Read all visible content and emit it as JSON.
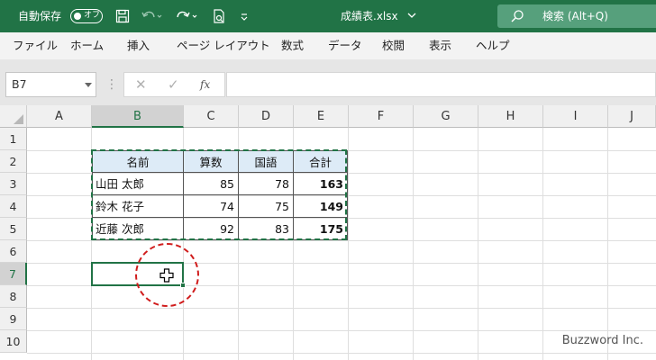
{
  "titlebar": {
    "autosave_label": "自動保存",
    "autosave_toggle": "オフ",
    "filename": "成績表.xlsx",
    "search_label": "検索 (Alt+Q)",
    "bg_color": "#217346"
  },
  "ribbon": {
    "tabs": [
      "ファイル",
      "ホーム",
      "挿入",
      "ページ レイアウト",
      "数式",
      "データ",
      "校閲",
      "表示",
      "ヘルプ"
    ]
  },
  "formula_bar": {
    "name_box": "B7",
    "cancel": "✕",
    "enter": "✓",
    "fx": "fx",
    "formula": ""
  },
  "sheet": {
    "columns": [
      "A",
      "B",
      "C",
      "D",
      "E",
      "F",
      "G",
      "H",
      "I",
      "J"
    ],
    "rows": [
      "1",
      "2",
      "3",
      "4",
      "5",
      "6",
      "7",
      "8",
      "9",
      "10"
    ],
    "selected_cell": "B7",
    "table": {
      "headers": [
        "名前",
        "算数",
        "国語",
        "合計"
      ],
      "rows": [
        [
          "山田 太郎",
          "85",
          "78",
          "163"
        ],
        [
          "鈴木 花子",
          "74",
          "75",
          "149"
        ],
        [
          "近藤 次郎",
          "92",
          "83",
          "175"
        ]
      ]
    },
    "header_fill": "#ddebf7",
    "accent_color": "#217346",
    "annotation_color": "#d01c1c"
  },
  "watermark": "Buzzword Inc."
}
